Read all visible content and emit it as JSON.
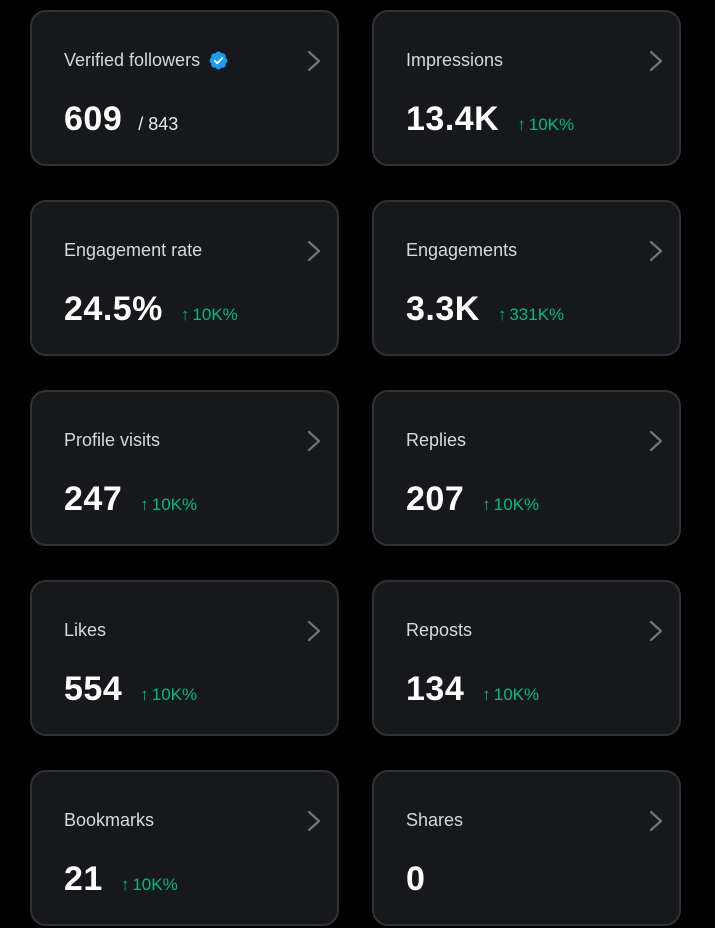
{
  "accent": "#1d9bf0",
  "positive_color": "#00ba7c",
  "cards": [
    {
      "label": "Verified followers",
      "value": "609",
      "suffix": "/ 843",
      "change": "",
      "verified": true
    },
    {
      "label": "Impressions",
      "value": "13.4K",
      "suffix": "",
      "change": "10K%"
    },
    {
      "label": "Engagement rate",
      "value": "24.5%",
      "suffix": "",
      "change": "10K%"
    },
    {
      "label": "Engagements",
      "value": "3.3K",
      "suffix": "",
      "change": "331K%"
    },
    {
      "label": "Profile visits",
      "value": "247",
      "suffix": "",
      "change": "10K%"
    },
    {
      "label": "Replies",
      "value": "207",
      "suffix": "",
      "change": "10K%"
    },
    {
      "label": "Likes",
      "value": "554",
      "suffix": "",
      "change": "10K%"
    },
    {
      "label": "Reposts",
      "value": "134",
      "suffix": "",
      "change": "10K%"
    },
    {
      "label": "Bookmarks",
      "value": "21",
      "suffix": "",
      "change": "10K%"
    },
    {
      "label": "Shares",
      "value": "0",
      "suffix": "",
      "change": ""
    }
  ],
  "icons": {
    "verified": "verified-badge-icon",
    "chevron": "chevron-right-icon",
    "arrow": "arrow-up-icon"
  }
}
